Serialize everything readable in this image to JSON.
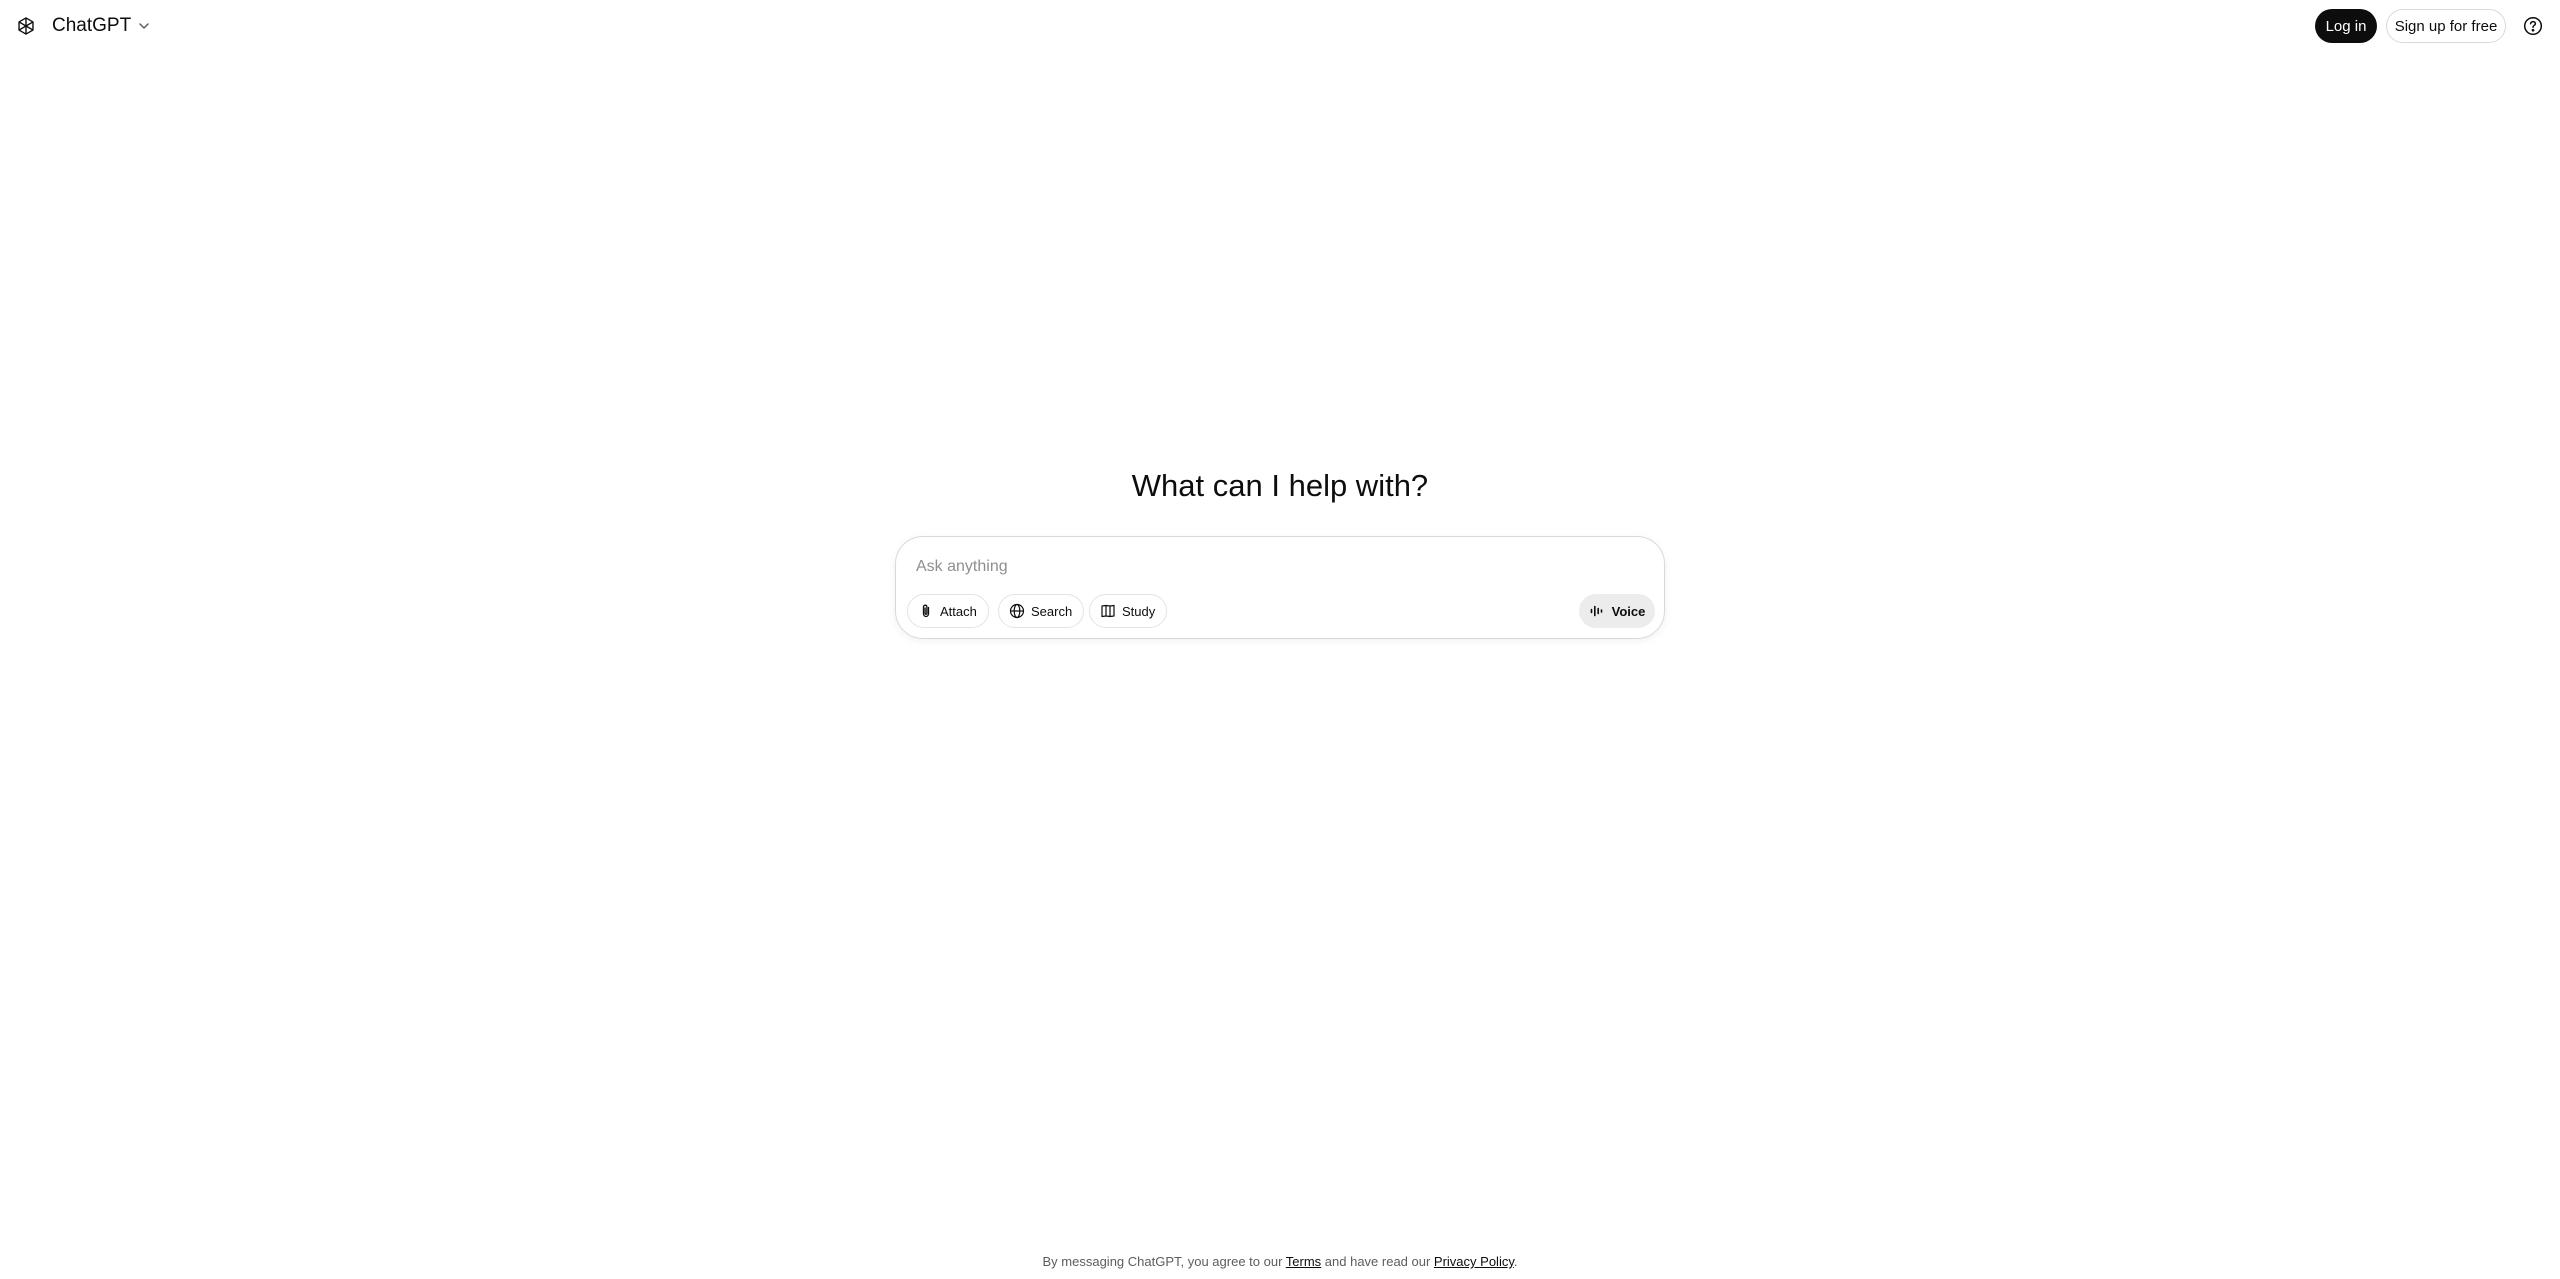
{
  "header": {
    "model_name": "ChatGPT",
    "login_label": "Log in",
    "signup_label": "Sign up for free"
  },
  "main": {
    "headline": "What can I help with?",
    "composer": {
      "placeholder": "Ask anything",
      "value": "",
      "tools": [
        {
          "label": "Attach",
          "icon": "paperclip-icon"
        },
        {
          "label": "Search",
          "icon": "globe-icon"
        },
        {
          "label": "Study",
          "icon": "book-icon"
        }
      ],
      "voice_label": "Voice"
    }
  },
  "footer": {
    "prefix": "By messaging ChatGPT, you agree to our ",
    "terms": "Terms",
    "middle": " and have read our ",
    "privacy": "Privacy Policy",
    "suffix": "."
  },
  "colors": {
    "primary_button": "#0d0d0d",
    "text": "#0d0d0d",
    "border": "#d9d9d9",
    "voice_bg": "#ececec",
    "muted": "#5d5d5d"
  }
}
